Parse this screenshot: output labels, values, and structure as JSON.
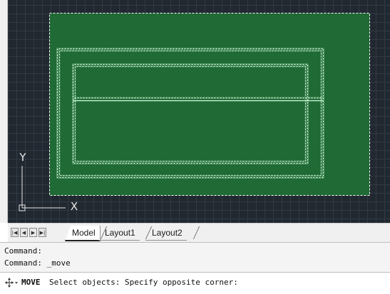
{
  "drawing": {
    "selection_fill": "#1f6a35",
    "grid_color": "#313a45",
    "background": "#212830",
    "ucs": {
      "y_label": "Y",
      "x_label": "X"
    }
  },
  "tabs": {
    "nav_icons": [
      "first-tab-icon",
      "previous-tab-icon",
      "next-tab-icon",
      "last-tab-icon"
    ],
    "items": [
      {
        "label": "Model",
        "active": true
      },
      {
        "label": "Layout1",
        "active": false
      },
      {
        "label": "Layout2",
        "active": false
      }
    ]
  },
  "command": {
    "history": [
      "Command:",
      "Command: _move"
    ],
    "current_command": "MOVE",
    "prompt": "Select objects: Specify opposite corner:",
    "icon": "move-icon"
  }
}
